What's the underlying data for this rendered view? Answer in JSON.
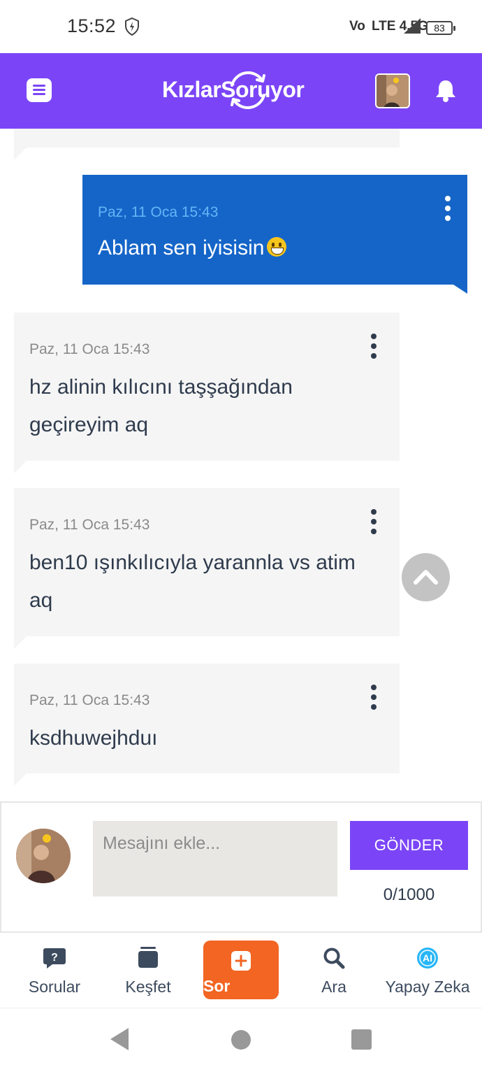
{
  "status_bar": {
    "time": "15:52",
    "network": "Vo  LTE 4.5G",
    "battery": "83"
  },
  "header": {
    "brand": "KızlarSoruyor",
    "brand_color": "#7b45f7",
    "menu_icon": "menu-icon",
    "notification_icon": "bell-icon"
  },
  "messages": [
    {
      "direction": "outgoing",
      "time": "Paz, 11 Oca 15:43",
      "text": "Ablam sen iyisisin",
      "emoji": "grinning-face"
    },
    {
      "direction": "incoming",
      "time": "Paz, 11 Oca 15:43",
      "text": "hz alinin kılıcını taşşağından geçireyim aq"
    },
    {
      "direction": "incoming",
      "time": "Paz, 11 Oca 15:43",
      "text": "ben10 ışınkılıcıyla yarannla vs atim aq"
    },
    {
      "direction": "incoming",
      "time": "Paz, 11 Oca 15:43",
      "text": "ksdhuwejhduı"
    }
  ],
  "composer": {
    "placeholder": "Mesajını ekle...",
    "value": "",
    "send_label": "GÖNDER",
    "char_count": "0/1000"
  },
  "bottom_nav": {
    "items": [
      {
        "label": "Sorular",
        "icon": "question-bubble-icon"
      },
      {
        "label": "Keşfet",
        "icon": "cards-icon"
      },
      {
        "label": "Sor",
        "icon": "plus-icon",
        "active": true
      },
      {
        "label": "Ara",
        "icon": "search-icon"
      },
      {
        "label": "Yapay Zeka",
        "icon": "ai-icon"
      }
    ]
  },
  "colors": {
    "outgoing_bubble": "#1565c8",
    "incoming_bubble": "#f5f5f5",
    "accent_orange": "#f26522"
  }
}
